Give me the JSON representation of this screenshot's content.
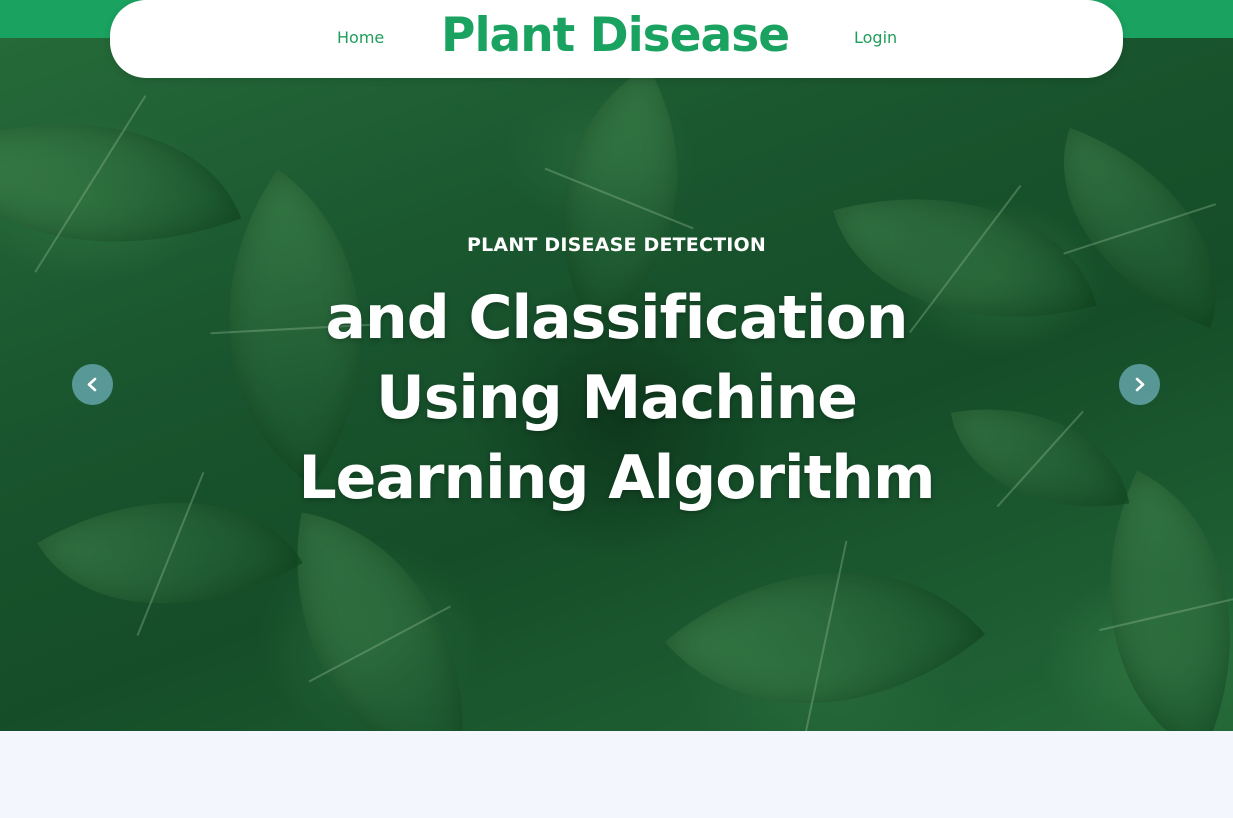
{
  "nav": {
    "home_label": "Home",
    "brand": "Plant Disease",
    "login_label": "Login"
  },
  "hero": {
    "kicker": "PLANT DISEASE DETECTION",
    "headline_lines": [
      "and Classification",
      "Using Machine",
      "Learning Algorithm"
    ],
    "prev_icon": "chevron-left-icon",
    "next_icon": "chevron-right-icon"
  },
  "colors": {
    "brand_green": "#1aa260",
    "nav_background": "#ffffff",
    "page_background": "#f3f6fd",
    "carousel_arrow": "#6eafb9"
  }
}
